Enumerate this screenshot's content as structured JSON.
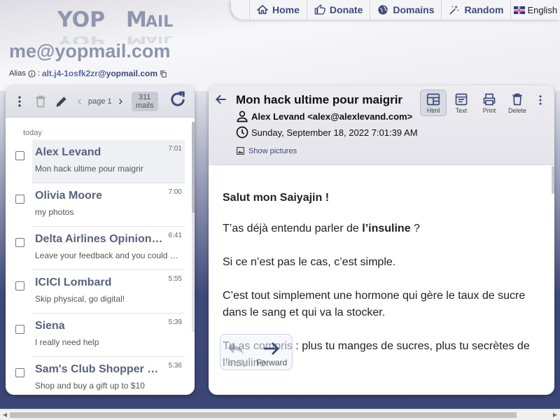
{
  "logo": {
    "text": "YOPMAIL"
  },
  "nav": {
    "items": [
      {
        "label": "Home",
        "icon": "home-icon"
      },
      {
        "label": "Donate",
        "icon": "thumb-up-icon"
      },
      {
        "label": "Domains",
        "icon": "globe-icon"
      },
      {
        "label": "Random",
        "icon": "magic-wand-icon"
      }
    ],
    "language": "English"
  },
  "account": {
    "email": "me@yopmail.com",
    "alias_label": "Alias",
    "alias_sep": ":",
    "alias_value": "alt.j4-1osfk2zr",
    "alias_domain": "@yopmail.com"
  },
  "inbox": {
    "page_label": "page 1",
    "mails_count": "311",
    "mails_label": "mails",
    "day_label": "today",
    "items": [
      {
        "from": "Alex Levand",
        "time": "7:01",
        "subject": "Mon hack ultime pour maigrir"
      },
      {
        "from": "Olivia Moore",
        "time": "7:00",
        "subject": "my photos"
      },
      {
        "from": "Delta Airlines Opinion…",
        "time": "6:41",
        "subject": "Leave your feedback and you could …"
      },
      {
        "from": "ICICI Lombard",
        "time": "5:55",
        "subject": "Skip physical, go digital!"
      },
      {
        "from": "Siena",
        "time": "5:39",
        "subject": "I really need help"
      },
      {
        "from": "Sam's Club Shopper …",
        "time": "5:36",
        "subject": "Shop and buy a gift up to $10"
      }
    ]
  },
  "message": {
    "subject": "Mon hack ultime pour maigrir",
    "sender": "Alex Levand <alex@alexlevand.com>",
    "date": "Sunday, September 18, 2022 7:01:39 AM",
    "show_pictures": "Show pictures",
    "tools": [
      {
        "label": "Html",
        "icon": "html-view-icon"
      },
      {
        "label": "Text",
        "icon": "text-view-icon"
      },
      {
        "label": "Print",
        "icon": "print-icon"
      },
      {
        "label": "Delete",
        "icon": "trash-icon"
      }
    ],
    "body": {
      "greeting": "Salut mon Saiyajin !",
      "p1_before": "T’as déjà entendu parler de ",
      "p1_bold": "l’insuline",
      "p1_after": " ?",
      "p2": "Si ce n’est pas le cas, c’est simple.",
      "p3": "C’est tout simplement une hormone qui gère le taux de sucre dans le sang et qui va la stocker.",
      "p4": "Tu as compris : plus tu manges de sucres, plus tu secrètes de l’insuline."
    },
    "reply_label": "Reply",
    "forward_label": "Forward"
  }
}
